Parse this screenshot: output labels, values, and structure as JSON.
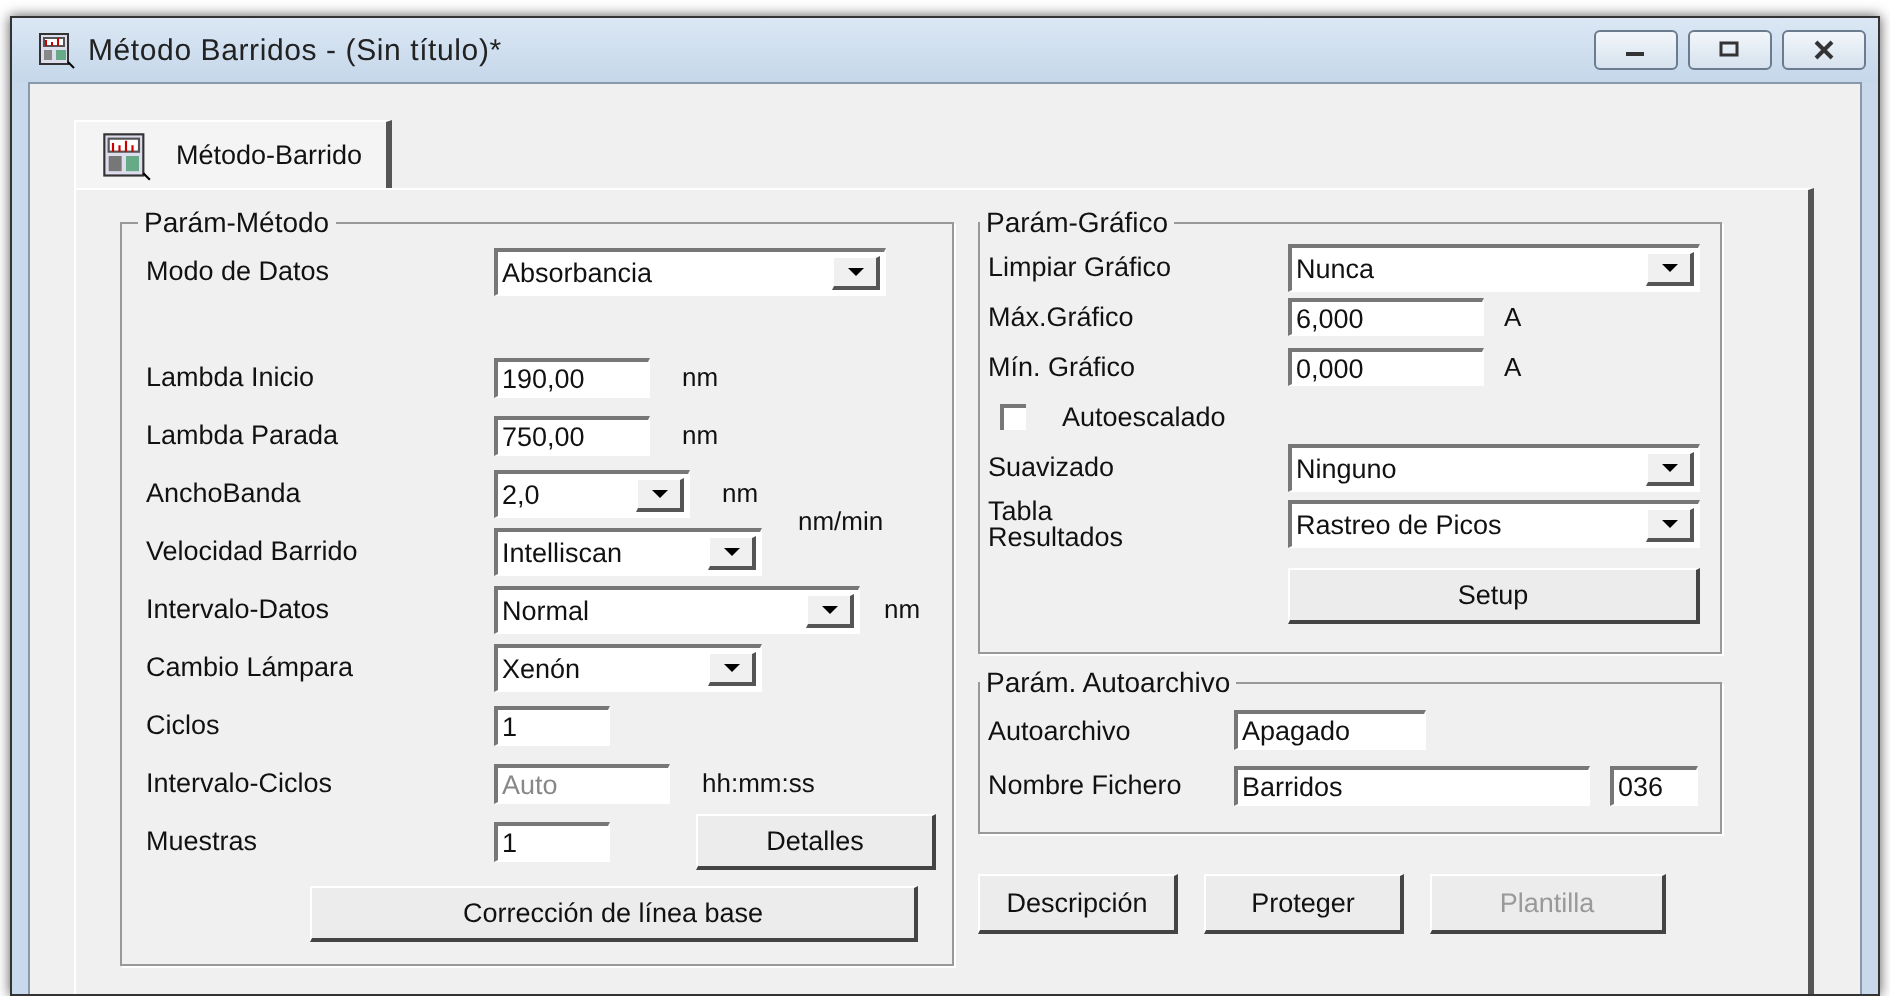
{
  "window": {
    "title": "Método Barridos - (Sin título)*"
  },
  "tabs": [
    {
      "label": "Método-Barrido",
      "selected": true
    }
  ],
  "method_group": {
    "title": "Parám-Método",
    "rows": [
      {
        "kind": "select",
        "label": "Modo de Datos",
        "value": "Absorbancia"
      },
      {
        "kind": "input",
        "label": "Lambda Inicio",
        "value": "190,00",
        "unit": "nm"
      },
      {
        "kind": "input",
        "label": "Lambda Parada",
        "value": "750,00",
        "unit": "nm"
      },
      {
        "kind": "select",
        "label": "AnchoBanda",
        "value": "2,0",
        "unit": "nm"
      },
      {
        "kind": "select",
        "label": "Velocidad Barrido",
        "value": "Intelliscan",
        "unit": "nm/min"
      },
      {
        "kind": "select",
        "label": "Intervalo-Datos",
        "value": "Normal",
        "unit": "nm"
      },
      {
        "kind": "select",
        "label": "Cambio Lámpara",
        "value": "Xenón"
      },
      {
        "kind": "input",
        "label": "Ciclos",
        "value": "1"
      },
      {
        "kind": "input",
        "label": "Intervalo-Ciclos",
        "value": "Auto",
        "unit": "hh:mm:ss",
        "disabled": true
      },
      {
        "kind": "input",
        "label": "Muestras",
        "value": "1",
        "button": "Detalles"
      }
    ],
    "baseline_button": "Corrección de línea base"
  },
  "graph_group": {
    "title": "Parám-Gráfico",
    "rows": [
      {
        "kind": "select",
        "label": "Limpiar Gráfico",
        "value": "Nunca"
      },
      {
        "kind": "input",
        "label": "Máx.Gráfico",
        "value": "6,000",
        "unit": "A"
      },
      {
        "kind": "input",
        "label": "Mín. Gráfico",
        "value": "0,000",
        "unit": "A"
      },
      {
        "kind": "checkbox",
        "label": "Autoescalado",
        "checked": false
      },
      {
        "kind": "select",
        "label": "Suavizado",
        "value": "Ninguno"
      },
      {
        "kind": "select",
        "label": "Tabla Resultados",
        "value": "Rastreo de Picos"
      }
    ],
    "setup_button": "Setup"
  },
  "autosave_group": {
    "title": "Parám. Autoarchivo",
    "autosave_label": "Autoarchivo",
    "autosave_value": "Apagado",
    "filename_label": "Nombre Fichero",
    "filename_value": "Barridos",
    "file_number": "036"
  },
  "buttons": [
    {
      "label": "Descripción",
      "disabled": false
    },
    {
      "label": "Proteger",
      "disabled": false
    },
    {
      "label": "Plantilla",
      "disabled": true
    }
  ]
}
